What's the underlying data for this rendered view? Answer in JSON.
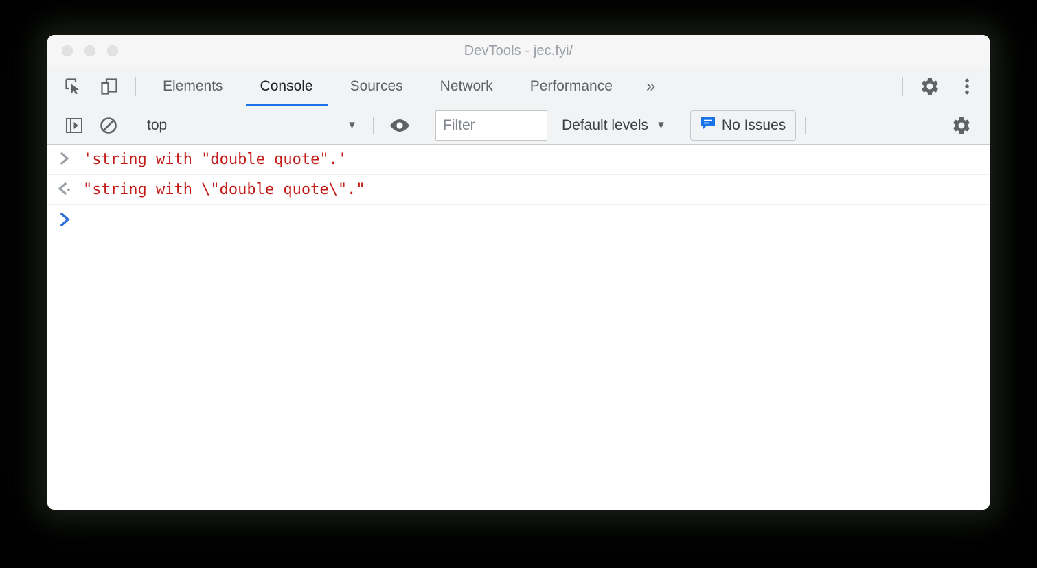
{
  "window": {
    "title": "DevTools - jec.fyi/",
    "traffic_lights": [
      "close",
      "minimize",
      "maximize"
    ]
  },
  "tabbar": {
    "left_icons": [
      {
        "name": "inspect-element-icon",
        "label": "Inspect element"
      },
      {
        "name": "device-toolbar-icon",
        "label": "Toggle device toolbar"
      }
    ],
    "tabs": [
      {
        "label": "Elements",
        "active": false
      },
      {
        "label": "Console",
        "active": true
      },
      {
        "label": "Sources",
        "active": false
      },
      {
        "label": "Network",
        "active": false
      },
      {
        "label": "Performance",
        "active": false
      }
    ],
    "overflow_label": "»",
    "right_icons": [
      {
        "name": "gear-icon",
        "label": "Settings"
      },
      {
        "name": "vertical-dots-icon",
        "label": "Customize and control DevTools"
      }
    ]
  },
  "console_toolbar": {
    "sidebar_toggle": "console-sidebar-icon",
    "clear_console": "clear-console-icon",
    "context": {
      "value": "top",
      "caret": "▼"
    },
    "live_expression": "eye-icon",
    "filter": {
      "value": "",
      "placeholder": "Filter"
    },
    "levels": {
      "label": "Default levels",
      "caret": "▼"
    },
    "issues": {
      "label": "No Issues",
      "icon": "issues-bubble-icon",
      "icon_color": "#1a73e8"
    },
    "settings_icon": "gear-icon"
  },
  "console": {
    "accent_color": "#1a73e8",
    "string_color": "#c41a16",
    "messages": [
      {
        "kind": "input",
        "gutter_icon": "prompt-chevron-icon",
        "text": "'string with \"double quote\".'"
      },
      {
        "kind": "result",
        "gutter_icon": "result-chevron-icon",
        "text": "\"string with \\\"double quote\\\".\""
      }
    ],
    "active_prompt": {
      "gutter_icon": "prompt-chevron-icon",
      "value": ""
    }
  }
}
